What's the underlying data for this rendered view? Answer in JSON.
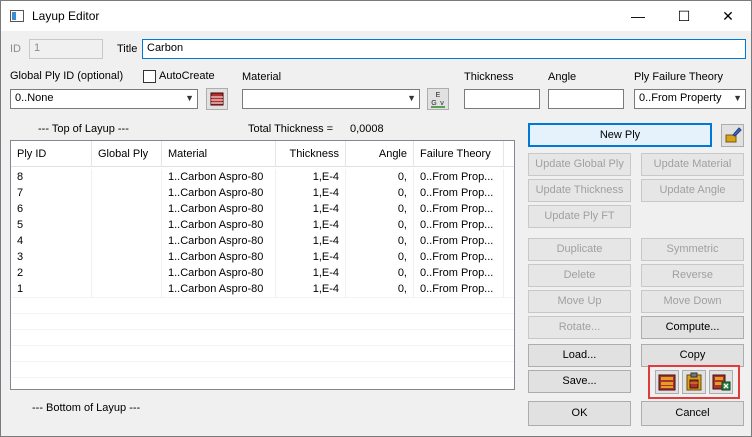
{
  "window": {
    "title": "Layup Editor",
    "minimize": "—",
    "maximize": "☐",
    "close": "✕"
  },
  "form": {
    "id_label": "ID",
    "id_value": "1",
    "title_label": "Title",
    "title_value": "Carbon",
    "global_ply_label": "Global Ply ID (optional)",
    "global_ply_value": "0..None",
    "autocreate_label": "AutoCreate",
    "material_label": "Material",
    "material_value": "",
    "thickness_label": "Thickness",
    "thickness_value": "",
    "angle_label": "Angle",
    "angle_value": "",
    "failure_theory_label": "Ply Failure Theory",
    "failure_theory_value": "0..From Property"
  },
  "layup": {
    "top_label": "---  Top of Layup  ---",
    "total_thickness_label": "Total Thickness  =",
    "total_thickness_value": "0,0008",
    "bottom_label": "---  Bottom of Layup  ---",
    "columns": [
      "Ply ID",
      "Global Ply",
      "Material",
      "Thickness",
      "Angle",
      "Failure Theory"
    ],
    "rows": [
      [
        "8",
        "",
        "1..Carbon Aspro-80",
        "1,E-4",
        "0,",
        "0..From Prop..."
      ],
      [
        "7",
        "",
        "1..Carbon Aspro-80",
        "1,E-4",
        "0,",
        "0..From Prop..."
      ],
      [
        "6",
        "",
        "1..Carbon Aspro-80",
        "1,E-4",
        "0,",
        "0..From Prop..."
      ],
      [
        "5",
        "",
        "1..Carbon Aspro-80",
        "1,E-4",
        "0,",
        "0..From Prop..."
      ],
      [
        "4",
        "",
        "1..Carbon Aspro-80",
        "1,E-4",
        "0,",
        "0..From Prop..."
      ],
      [
        "3",
        "",
        "1..Carbon Aspro-80",
        "1,E-4",
        "0,",
        "0..From Prop..."
      ],
      [
        "2",
        "",
        "1..Carbon Aspro-80",
        "1,E-4",
        "0,",
        "0..From Prop..."
      ],
      [
        "1",
        "",
        "1..Carbon Aspro-80",
        "1,E-4",
        "0,",
        "0..From Prop..."
      ]
    ]
  },
  "buttons": {
    "new_ply": "New Ply",
    "update_global_ply": "Update Global Ply",
    "update_material": "Update Material",
    "update_thickness": "Update Thickness",
    "update_angle": "Update Angle",
    "update_ply_ft": "Update Ply FT",
    "duplicate": "Duplicate",
    "symmetric": "Symmetric",
    "delete": "Delete",
    "reverse": "Reverse",
    "move_up": "Move Up",
    "move_down": "Move Down",
    "rotate": "Rotate...",
    "compute": "Compute...",
    "load": "Load...",
    "copy": "Copy",
    "save": "Save...",
    "ok": "OK",
    "cancel": "Cancel"
  },
  "icons": {
    "global_ply_browse": "layer-stack-icon",
    "material_browse": "material-egv-icon",
    "new_ply_extra": "paint-brush-icon",
    "toolbar": [
      "layup-stack-icon",
      "paste-layup-icon",
      "export-layup-icon"
    ]
  }
}
